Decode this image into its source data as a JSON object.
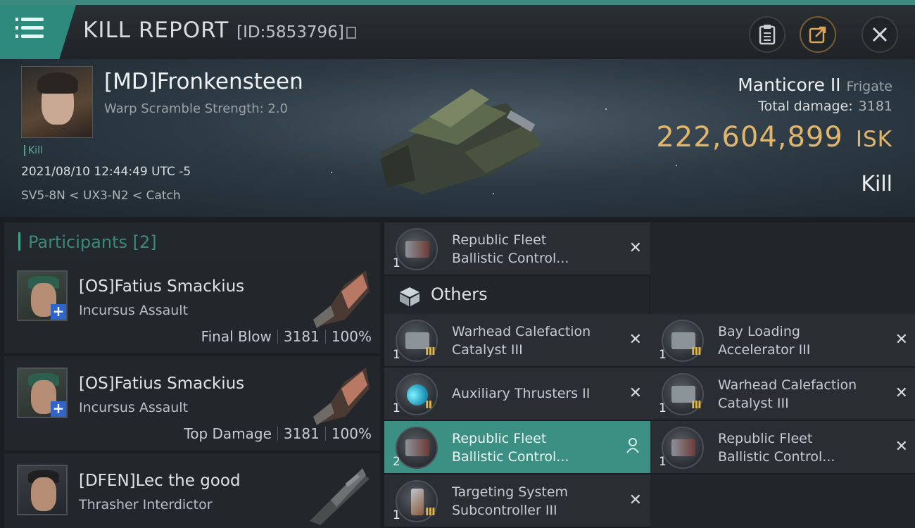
{
  "header": {
    "title": "KILL REPORT",
    "report_id": "[ID:5853796]"
  },
  "victim": {
    "name": "[MD]Fronkensteen",
    "warp_scramble": "Warp Scramble Strength: 2.0",
    "tag": "Kill",
    "datetime": "2021/08/10 12:44:49 UTC -5",
    "location": "SV5-8N < UX3-N2 < Catch",
    "ship_name": "Manticore II",
    "ship_class": "Frigate",
    "total_damage_label": "Total damage:",
    "total_damage": "3181",
    "isk_value": "222,604,899",
    "isk_label": "ISK",
    "result": "Kill"
  },
  "participants": {
    "label": "Participants [2]",
    "rows": [
      {
        "name": "[OS]Fatius Smackius",
        "ship": "Incursus Assault",
        "role": "Final Blow",
        "damage": "3181",
        "percent": "100%"
      },
      {
        "name": "[OS]Fatius Smackius",
        "ship": "Incursus Assault",
        "role": "Top Damage",
        "damage": "3181",
        "percent": "100%"
      },
      {
        "name": "[DFEN]Lec the good",
        "ship": "Thrasher Interdictor",
        "role": "",
        "damage": "",
        "percent": ""
      }
    ]
  },
  "items": {
    "top_item": {
      "qty": "1",
      "line1": "Republic Fleet",
      "line2": "Ballistic Control...",
      "state": "destroyed"
    },
    "others_label": "Others",
    "others": [
      {
        "qty": "1",
        "line1": "Warhead Calefaction",
        "line2": "Catalyst III",
        "tier": "III",
        "state": "destroyed"
      },
      {
        "qty": "1",
        "line1": "Bay Loading",
        "line2": "Accelerator III",
        "tier": "III",
        "state": "destroyed"
      },
      {
        "qty": "1",
        "line1": "Auxiliary Thrusters II",
        "line2": "",
        "tier": "II",
        "state": "destroyed"
      },
      {
        "qty": "1",
        "line1": "Warhead Calefaction",
        "line2": "Catalyst III",
        "tier": "III",
        "state": "destroyed"
      },
      {
        "qty": "2",
        "line1": "Republic Fleet",
        "line2": "Ballistic Control...",
        "tier": "",
        "state": "dropped"
      },
      {
        "qty": "1",
        "line1": "Republic Fleet",
        "line2": "Ballistic Control...",
        "tier": "",
        "state": "destroyed"
      },
      {
        "qty": "1",
        "line1": "Targeting System",
        "line2": "Subcontroller III",
        "tier": "III",
        "state": "destroyed"
      }
    ]
  },
  "colors": {
    "accent": "#3b8f83",
    "isk": "#e2b66a",
    "tier": "#e2b84c",
    "background": "#1b1f23"
  },
  "icons": {
    "menu": "hamburger-icon",
    "clipboard": "clipboard-icon",
    "share": "share-icon",
    "close": "close-icon",
    "copy": "copy-icon",
    "others": "cube-icon",
    "destroyed": "x-icon",
    "dropped": "person-icon"
  }
}
